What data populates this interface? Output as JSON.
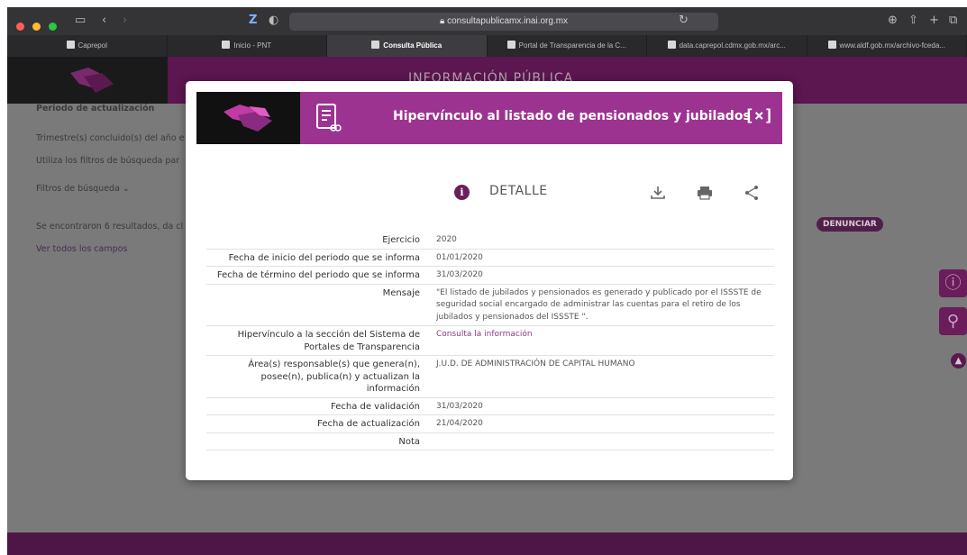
{
  "browser": {
    "url": "consultapublicamx.inai.org.mx",
    "tabs": [
      {
        "label": "Caprepol",
        "active": false
      },
      {
        "label": "Inicio - PNT",
        "active": false
      },
      {
        "label": "Consulta Pública",
        "active": true
      },
      {
        "label": "Portal de Transparencia de la C...",
        "active": false
      },
      {
        "label": "data.caprepol.cdmx.gob.mx/arc...",
        "active": false
      },
      {
        "label": "www.aldf.gob.mx/archivo-fceda...",
        "active": false
      }
    ]
  },
  "background_page": {
    "header_title": "INFORMACIÓN PÚBLICA",
    "lines": [
      "Periodo de actualización",
      "Trimestre(s) concluido(s) del año e",
      "Utiliza los filtros de búsqueda par",
      "Filtros de búsqueda ⌄",
      "Se encontraron 6 resultados, da cl",
      "Ver todos los campos"
    ],
    "denunciar_label": "DENUNCIAR"
  },
  "modal": {
    "title": "Hipervínculo al listado de pensionados y jubilados",
    "close_label": "[×]",
    "detail_label": "DETALLE",
    "rows": [
      {
        "label": "Ejercicio",
        "value": "2020",
        "link": false
      },
      {
        "label": "Fecha de inicio del periodo que se informa",
        "value": "01/01/2020",
        "link": false
      },
      {
        "label": "Fecha de término del periodo que se informa",
        "value": "31/03/2020",
        "link": false
      },
      {
        "label": "Mensaje",
        "value": "\"El listado de jubilados y pensionados es generado y publicado por el ISSSTE de seguridad social encargado de administrar las cuentas para el retiro de los jubilados y pensionados del ISSSTE \".",
        "link": false
      },
      {
        "label": "Hipervínculo a la sección del Sistema de Portales de Transparencia",
        "value": "Consulta la información",
        "link": true
      },
      {
        "label": "Área(s) responsable(s) que genera(n), posee(n), publica(n) y actualizan la información",
        "value": "J.U.D. DE ADMINISTRACIÓN DE CAPITAL HUMANO",
        "link": false
      },
      {
        "label": "Fecha de validación",
        "value": "31/03/2020",
        "link": false
      },
      {
        "label": "Fecha de actualización",
        "value": "21/04/2020",
        "link": false
      },
      {
        "label": "Nota",
        "value": "",
        "link": false
      }
    ]
  },
  "colors": {
    "brand_purple": "#9d3390",
    "dark_purple": "#5c1650",
    "link": "#8b3b82"
  }
}
